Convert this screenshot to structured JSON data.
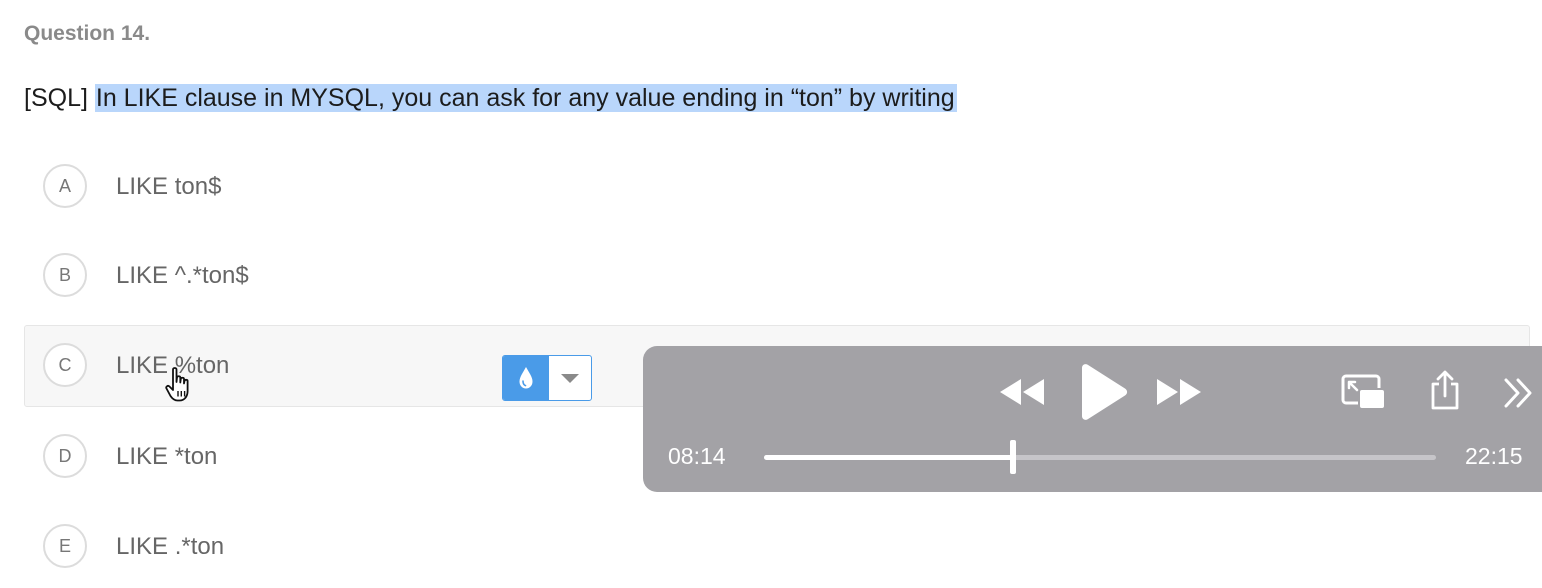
{
  "question": {
    "number_label": "Question 14.",
    "tag": "[SQL]",
    "text": "In LIKE clause in MYSQL, you can ask for any value ending in “ton” by writing"
  },
  "options": [
    {
      "letter": "A",
      "text": "LIKE ton$"
    },
    {
      "letter": "B",
      "text": "LIKE ^.*ton$"
    },
    {
      "letter": "C",
      "text": "LIKE %ton"
    },
    {
      "letter": "D",
      "text": "LIKE *ton"
    },
    {
      "letter": "E",
      "text": "LIKE .*ton"
    }
  ],
  "hovered_option": "C",
  "color_picker": {
    "icon": "drop-icon",
    "menu_icon": "caret-down-icon",
    "accent": "#4a9be8"
  },
  "video_player": {
    "current_time": "08:14",
    "total_time": "22:15",
    "progress_fraction": 0.37,
    "background": "#a3a2a6",
    "controls": [
      "rewind-icon",
      "play-icon",
      "fast-forward-icon",
      "picture-in-picture-icon",
      "share-icon",
      "more-icon"
    ]
  }
}
